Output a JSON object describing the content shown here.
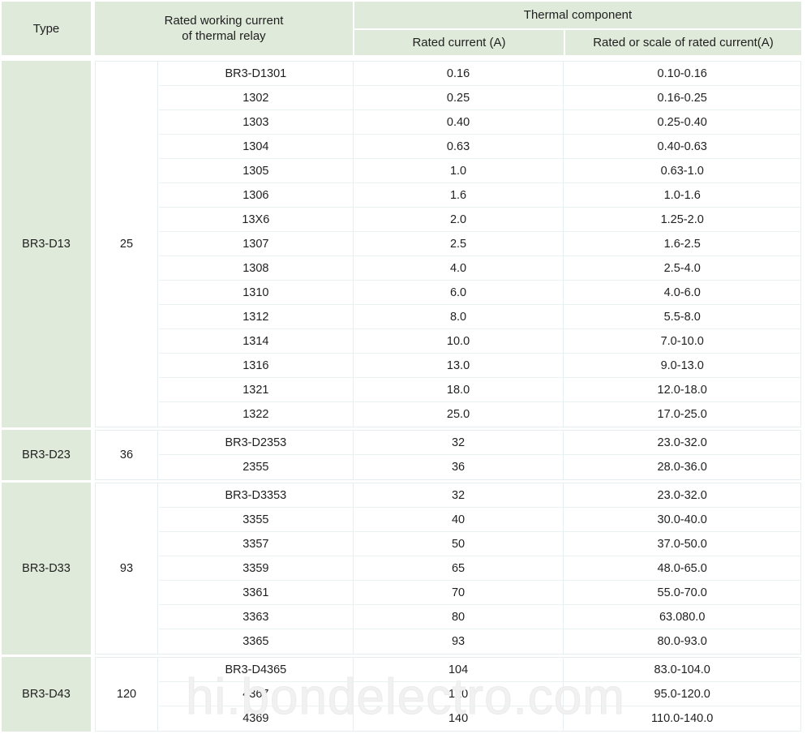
{
  "watermark": {
    "text": "hi.bondelectro.com"
  },
  "colors": {
    "header_green": "#dfeada",
    "grid_line": "#e7eef1",
    "row_line": "#eaf1f3",
    "text": "#1f1f1f",
    "watermark": "#f1f1f1"
  },
  "header": {
    "type": "Type",
    "rated_working_current": "Rated working current\nof thermal relay",
    "rated_working_current_line1": "Rated working current",
    "rated_working_current_line2": "of thermal relay",
    "thermal_component": "Thermal component",
    "rated_current": "Rated current (A)",
    "rated_or_scale": "Rated or scale of rated current(A)"
  },
  "groups": [
    {
      "type": "BR3-D13",
      "rated_working_current": "25",
      "rows": [
        {
          "component": "BR3-D1301",
          "rated_current": "0.16",
          "scale": "0.10-0.16"
        },
        {
          "component": "1302",
          "rated_current": "0.25",
          "scale": "0.16-0.25"
        },
        {
          "component": "1303",
          "rated_current": "0.40",
          "scale": "0.25-0.40"
        },
        {
          "component": "1304",
          "rated_current": "0.63",
          "scale": "0.40-0.63"
        },
        {
          "component": "1305",
          "rated_current": "1.0",
          "scale": "0.63-1.0"
        },
        {
          "component": "1306",
          "rated_current": "1.6",
          "scale": "1.0-1.6"
        },
        {
          "component": "13X6",
          "rated_current": "2.0",
          "scale": "1.25-2.0"
        },
        {
          "component": "1307",
          "rated_current": "2.5",
          "scale": "1.6-2.5"
        },
        {
          "component": "1308",
          "rated_current": "4.0",
          "scale": "2.5-4.0"
        },
        {
          "component": "1310",
          "rated_current": "6.0",
          "scale": "4.0-6.0"
        },
        {
          "component": "1312",
          "rated_current": "8.0",
          "scale": "5.5-8.0"
        },
        {
          "component": "1314",
          "rated_current": "10.0",
          "scale": "7.0-10.0"
        },
        {
          "component": "1316",
          "rated_current": "13.0",
          "scale": "9.0-13.0"
        },
        {
          "component": "1321",
          "rated_current": "18.0",
          "scale": "12.0-18.0"
        },
        {
          "component": "1322",
          "rated_current": "25.0",
          "scale": "17.0-25.0"
        }
      ]
    },
    {
      "type": "BR3-D23",
      "rated_working_current": "36",
      "rows": [
        {
          "component": "BR3-D2353",
          "rated_current": "32",
          "scale": "23.0-32.0"
        },
        {
          "component": "2355",
          "rated_current": "36",
          "scale": "28.0-36.0"
        }
      ]
    },
    {
      "type": "BR3-D33",
      "rated_working_current": "93",
      "rows": [
        {
          "component": "BR3-D3353",
          "rated_current": "32",
          "scale": "23.0-32.0"
        },
        {
          "component": "3355",
          "rated_current": "40",
          "scale": "30.0-40.0"
        },
        {
          "component": "3357",
          "rated_current": "50",
          "scale": "37.0-50.0"
        },
        {
          "component": "3359",
          "rated_current": "65",
          "scale": "48.0-65.0"
        },
        {
          "component": "3361",
          "rated_current": "70",
          "scale": "55.0-70.0"
        },
        {
          "component": "3363",
          "rated_current": "80",
          "scale": "63.080.0"
        },
        {
          "component": "3365",
          "rated_current": "93",
          "scale": "80.0-93.0"
        }
      ]
    },
    {
      "type": "BR3-D43",
      "rated_working_current": "120",
      "rows": [
        {
          "component": "BR3-D4365",
          "rated_current": "104",
          "scale": "83.0-104.0"
        },
        {
          "component": "4367",
          "rated_current": "120",
          "scale": "95.0-120.0"
        },
        {
          "component": "4369",
          "rated_current": "140",
          "scale": "110.0-140.0"
        }
      ]
    }
  ]
}
